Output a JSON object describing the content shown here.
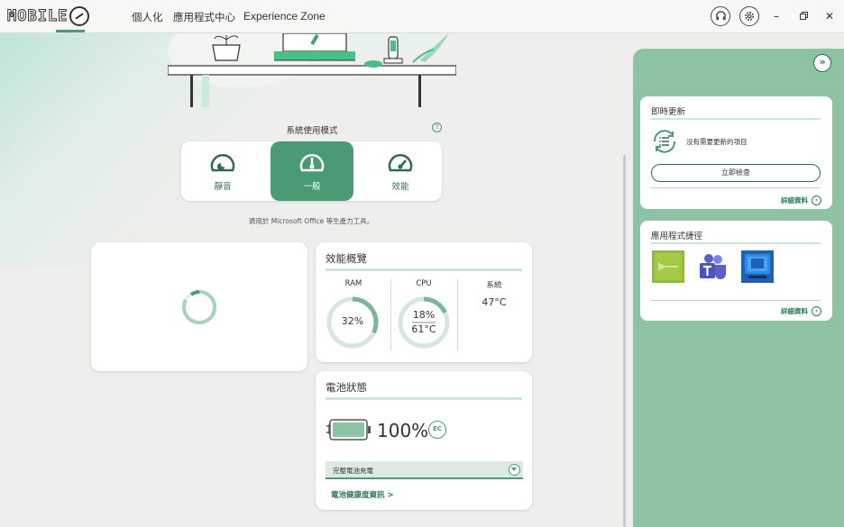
{
  "header": {
    "logo_text": "MOBILE",
    "logo_number": "01",
    "nav": [
      {
        "label": "個人化"
      },
      {
        "label": "應用程式中心"
      },
      {
        "label": "Experience Zone"
      }
    ],
    "icons": [
      "headset-icon",
      "settings-icon"
    ],
    "window_controls": [
      "minimize",
      "restore",
      "close"
    ]
  },
  "mode": {
    "title": "系統使用模式",
    "options": [
      {
        "label": "靜音",
        "active": false
      },
      {
        "label": "一般",
        "active": true
      },
      {
        "label": "效能",
        "active": false
      }
    ],
    "description": "適用於 Microsoft Office 等生產力工具。"
  },
  "performance": {
    "title": "效能概覽",
    "ram": {
      "label": "RAM",
      "value": "32%",
      "percent": 32
    },
    "cpu": {
      "label": "CPU",
      "usage": "18%",
      "temp": "61°C",
      "percent": 18
    },
    "system": {
      "label": "系統",
      "temp": "47°C"
    }
  },
  "battery": {
    "title": "電池狀態",
    "level": "100%",
    "level_fraction": 1.0,
    "eco_badge": "EC",
    "mode_label": "完整電池充電",
    "health_link": "電池健康度資訊 >"
  },
  "right_panel": {
    "updates": {
      "title": "即時更新",
      "status": "沒有需要更新的項目",
      "check_button": "立即檢查",
      "detail_link": "詳細資料"
    },
    "shortcuts": {
      "title": "應用程式捷徑",
      "apps": [
        {
          "name": "audio-app-icon"
        },
        {
          "name": "teams-icon"
        },
        {
          "name": "desktop-app-icon"
        }
      ],
      "detail_link": "詳細資料"
    }
  },
  "colors": {
    "accent": "#4a9a76",
    "accent_dark": "#2d6b52",
    "panel": "#8ec2a5",
    "ring_track": "#d6e8de",
    "ring_fill": "#7cb69a"
  }
}
